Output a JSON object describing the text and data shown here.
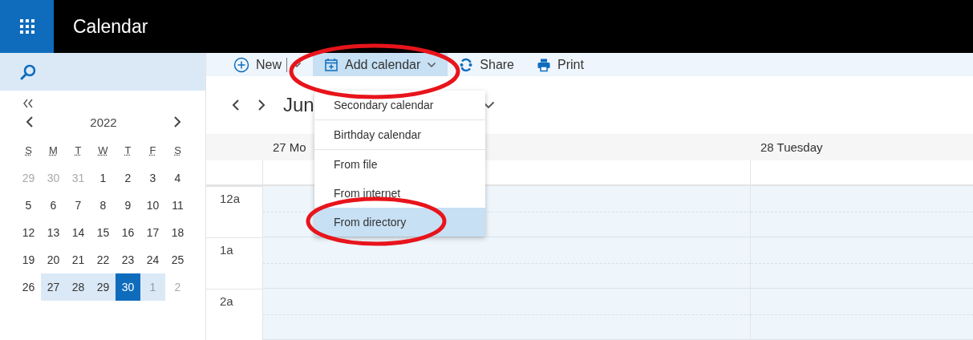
{
  "app": {
    "title": "Calendar"
  },
  "mini_calendar": {
    "year": "2022",
    "weekdays": [
      "S",
      "M",
      "T",
      "W",
      "T",
      "F",
      "S"
    ],
    "weeks": [
      [
        {
          "day": "29",
          "muted": true,
          "in_week": false,
          "selected": false
        },
        {
          "day": "30",
          "muted": true,
          "in_week": false,
          "selected": false
        },
        {
          "day": "31",
          "muted": true,
          "in_week": false,
          "selected": false
        },
        {
          "day": "1",
          "muted": false,
          "in_week": false,
          "selected": false
        },
        {
          "day": "2",
          "muted": false,
          "in_week": false,
          "selected": false
        },
        {
          "day": "3",
          "muted": false,
          "in_week": false,
          "selected": false
        },
        {
          "day": "4",
          "muted": false,
          "in_week": false,
          "selected": false
        }
      ],
      [
        {
          "day": "5",
          "muted": false,
          "in_week": false,
          "selected": false
        },
        {
          "day": "6",
          "muted": false,
          "in_week": false,
          "selected": false
        },
        {
          "day": "7",
          "muted": false,
          "in_week": false,
          "selected": false
        },
        {
          "day": "8",
          "muted": false,
          "in_week": false,
          "selected": false
        },
        {
          "day": "9",
          "muted": false,
          "in_week": false,
          "selected": false
        },
        {
          "day": "10",
          "muted": false,
          "in_week": false,
          "selected": false
        },
        {
          "day": "11",
          "muted": false,
          "in_week": false,
          "selected": false
        }
      ],
      [
        {
          "day": "12",
          "muted": false,
          "in_week": false,
          "selected": false
        },
        {
          "day": "13",
          "muted": false,
          "in_week": false,
          "selected": false
        },
        {
          "day": "14",
          "muted": false,
          "in_week": false,
          "selected": false
        },
        {
          "day": "15",
          "muted": false,
          "in_week": false,
          "selected": false
        },
        {
          "day": "16",
          "muted": false,
          "in_week": false,
          "selected": false
        },
        {
          "day": "17",
          "muted": false,
          "in_week": false,
          "selected": false
        },
        {
          "day": "18",
          "muted": false,
          "in_week": false,
          "selected": false
        }
      ],
      [
        {
          "day": "19",
          "muted": false,
          "in_week": false,
          "selected": false
        },
        {
          "day": "20",
          "muted": false,
          "in_week": false,
          "selected": false
        },
        {
          "day": "21",
          "muted": false,
          "in_week": false,
          "selected": false
        },
        {
          "day": "22",
          "muted": false,
          "in_week": false,
          "selected": false
        },
        {
          "day": "23",
          "muted": false,
          "in_week": false,
          "selected": false
        },
        {
          "day": "24",
          "muted": false,
          "in_week": false,
          "selected": false
        },
        {
          "day": "25",
          "muted": false,
          "in_week": false,
          "selected": false
        }
      ],
      [
        {
          "day": "26",
          "muted": false,
          "in_week": false,
          "selected": false
        },
        {
          "day": "27",
          "muted": false,
          "in_week": true,
          "selected": false
        },
        {
          "day": "28",
          "muted": false,
          "in_week": true,
          "selected": false
        },
        {
          "day": "29",
          "muted": false,
          "in_week": true,
          "selected": false
        },
        {
          "day": "30",
          "muted": false,
          "in_week": true,
          "selected": true
        },
        {
          "day": "1",
          "muted": true,
          "in_week": true,
          "selected": false
        },
        {
          "day": "2",
          "muted": true,
          "in_week": false,
          "selected": false
        }
      ]
    ]
  },
  "toolbar": [
    {
      "label": "New",
      "kind": "new",
      "selected": false
    },
    {
      "label": "Add calendar",
      "kind": "add",
      "selected": true
    },
    {
      "label": "Share",
      "kind": "share",
      "selected": false
    },
    {
      "label": "Print",
      "kind": "print",
      "selected": false
    }
  ],
  "menu": [
    {
      "label": "Secondary calendar",
      "selected": false,
      "divider_after": true
    },
    {
      "label": "Birthday calendar",
      "selected": false,
      "divider_after": true
    },
    {
      "label": "From file",
      "selected": false,
      "divider_after": false
    },
    {
      "label": "From internet",
      "selected": false,
      "divider_after": false
    },
    {
      "label": "From directory",
      "selected": true,
      "divider_after": false
    }
  ],
  "view": {
    "month": "Jun",
    "days": [
      "27 Mo",
      "28 Tuesday"
    ],
    "hours": [
      "12a",
      "1a",
      "2a"
    ]
  }
}
